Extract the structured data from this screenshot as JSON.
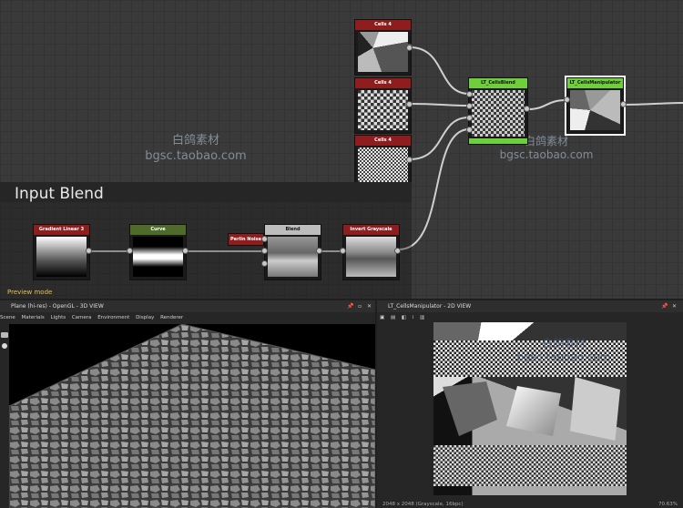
{
  "graph": {
    "frame_title": "Input Blend",
    "preview_label": "Preview mode",
    "watermark": {
      "line1": "白鸽素材",
      "line2": "bgsc.taobao.com"
    }
  },
  "nodes": {
    "cells_top": "Cells 4",
    "cells_mid": "Cells 4",
    "cells_bot": "Cells 4",
    "cellsblend": "LT_CellsBlend",
    "cellsmanip": "LT_CellsManipulator",
    "gradient": "Gradient Linear 3",
    "curve": "Curve",
    "perlin": "Perlin Noise",
    "blend": "Blend",
    "invert": "Invert Grayscale"
  },
  "colors": {
    "header_red": "#8f1d1d",
    "header_green": "#6fcf3a",
    "header_gray": "#bdbdbd",
    "header_olive": "#4f6b2a"
  },
  "view3d": {
    "title": "Plane (hi-res) - OpenGL - 3D VIEW",
    "menu": [
      "Scene",
      "Materials",
      "Lights",
      "Camera",
      "Environment",
      "Display",
      "Renderer"
    ]
  },
  "view2d": {
    "title": "LT_CellsManipulator - 2D VIEW",
    "footer": "2048 x 2048 (Grayscale, 16bpc)",
    "zoom": "70.63%"
  }
}
